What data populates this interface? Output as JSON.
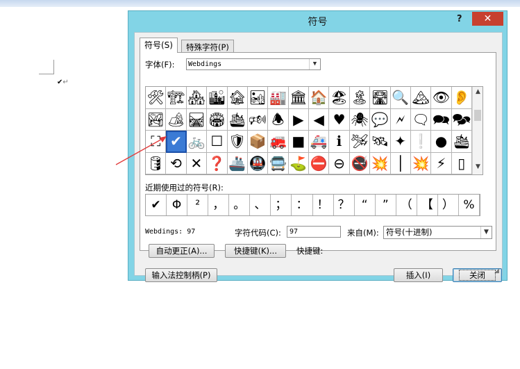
{
  "document": {
    "checkmark": "✔",
    "return_mark": "↵"
  },
  "dialog": {
    "title": "符号",
    "help": "?",
    "close": "✕",
    "tabs": [
      {
        "label": "符号(S)"
      },
      {
        "label": "特殊字符(P)"
      }
    ],
    "font_label": "字体(F):",
    "font_value": "Webdings",
    "symbol_grid": [
      [
        "🛠",
        "🏗",
        "🏘",
        "🏙",
        "🏚",
        "🏜",
        "🏭",
        "🏛",
        "🏠",
        "🏖",
        "🏝",
        "🛣",
        "🔍",
        "🏔",
        "👁",
        "👂"
      ],
      [
        "🏞",
        "🏕",
        "🛤",
        "🏟",
        "🛳",
        "🕬",
        "🕭",
        "▶",
        "◀",
        "♥",
        "🕷",
        "💬",
        "🗲",
        "🗨",
        "🗪",
        "🗫"
      ],
      [
        "⛶",
        "✔",
        "🚲",
        "☐",
        "🛡",
        "📦",
        "🚒",
        "■",
        "🚑",
        "ℹ",
        "🛩",
        "🛰",
        "✦",
        "❕",
        "●",
        "🛳"
      ],
      [
        "🛢",
        "⟲",
        "✕",
        "❓",
        "🚢",
        "🚇",
        "🚍",
        "⛳",
        "⛔",
        "⊖",
        "🚭",
        "💥",
        "│",
        "💥",
        "⚡",
        "▯"
      ]
    ],
    "selected_symbol": {
      "row": 2,
      "col": 1
    },
    "recent_label": "近期使用过的符号(R):",
    "recent_symbols": [
      "✔",
      "Φ",
      "²",
      "，",
      "。",
      "、",
      "；",
      "：",
      "！",
      "？",
      "“",
      "”",
      "（",
      "【",
      "）",
      "%"
    ],
    "char_info": "Webdings: 97",
    "char_code_label": "字符代码(C):",
    "char_code_value": "97",
    "from_label": "来自(M):",
    "from_value": "符号(十进制)",
    "autocorrect_button": "自动更正(A)...",
    "shortcut_button": "快捷键(K)...",
    "shortcut_label": "快捷键:",
    "ime_button": "输入法控制柄(P)",
    "insert_button": "插入(I)",
    "close_button": "关闭"
  }
}
